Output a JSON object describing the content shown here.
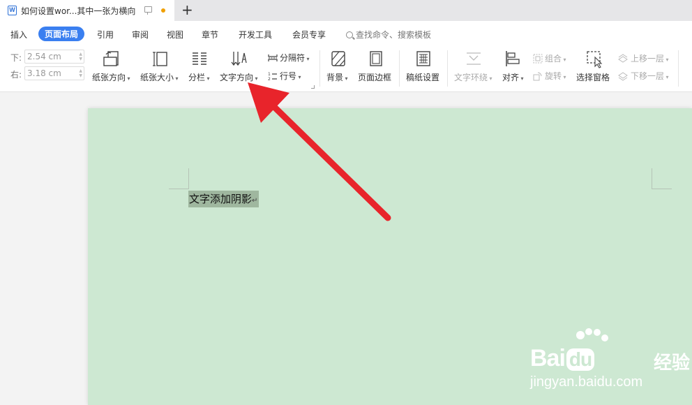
{
  "tab": {
    "title": "如何设置wor...其中一张为横向",
    "app_icon": "W",
    "new_tab": "+"
  },
  "menu": {
    "items": [
      "插入",
      "页面布局",
      "引用",
      "审阅",
      "视图",
      "章节",
      "开发工具",
      "会员专享"
    ],
    "active": "页面布局",
    "search_text": "查找命令、搜索模板"
  },
  "margins": {
    "bottom_label": "下:",
    "bottom_value": "2.54 cm",
    "right_label": "右:",
    "right_value": "3.18 cm"
  },
  "ribbon": {
    "paper_orientation": "纸张方向",
    "paper_size": "纸张大小",
    "columns": "分栏",
    "text_direction": "文字方向",
    "separator": "分隔符",
    "line_numbers": "行号",
    "background": "背景",
    "page_border": "页面边框",
    "manuscript": "稿纸设置",
    "text_wrap": "文字环绕",
    "align": "对齐",
    "group": "组合",
    "rotate": "旋转",
    "selection_pane": "选择窗格",
    "bring_forward": "上移一层",
    "send_backward": "下移一层"
  },
  "document": {
    "selected_text": "文字添加阴影",
    "return_mark": "↵",
    "page_color": "#cde8d2"
  },
  "watermark": {
    "brand": "Bai",
    "brand2": "du",
    "suffix": "经验",
    "url": "jingyan.baidu.com"
  },
  "colors": {
    "accent": "#3a7ff0",
    "arrow": "#e8242b",
    "modified_dot": "#f0a000"
  }
}
